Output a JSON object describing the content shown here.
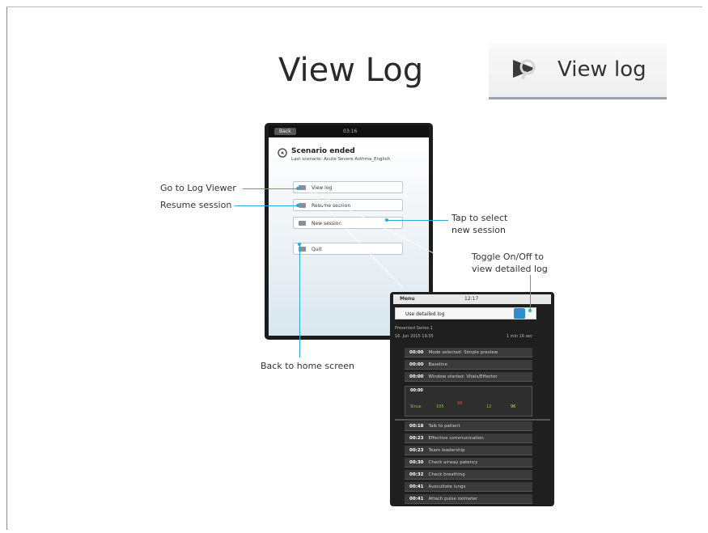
{
  "slide": {
    "title": "View Log",
    "view_log_button_label": "View log"
  },
  "callouts": {
    "go_to_log_viewer": "Go to Log Viewer",
    "resume_session": "Resume session",
    "tap_to_select": "Tap to select",
    "new_session": "new session",
    "toggle_line1": "Toggle On/Off to",
    "toggle_line2": "view detailed log",
    "back_to_home": "Back to home screen"
  },
  "tablet1": {
    "back_label": "Back",
    "time": "03:16",
    "title": "Scenario ended",
    "subtitle": "Last scenario: Acute Severe Asthma_English",
    "buttons": [
      "View log",
      "Resume session",
      "New session",
      "Quit"
    ]
  },
  "tablet2": {
    "menu_label": "Menu",
    "time": "12:17",
    "toggle_label": "Use detailed log",
    "header": "Presented Series 1",
    "date": "16. Jun 2015 19:35",
    "duration": "1 min 16 sec",
    "entries": [
      {
        "time": "00:00",
        "text": "Mode selected: Simple preview"
      },
      {
        "time": "00:00",
        "text": "Baseline"
      },
      {
        "time": "00:00",
        "text": "Window started: Vitals/Effector"
      },
      {
        "time": "00:00",
        "text": ""
      },
      {
        "time": "00:18",
        "text": "Talk to patient"
      },
      {
        "time": "00:23",
        "text": "Effective communication"
      },
      {
        "time": "00:23",
        "text": "Team leadership"
      },
      {
        "time": "00:30",
        "text": "Check airway patency"
      },
      {
        "time": "00:32",
        "text": "Check breathing"
      },
      {
        "time": "00:41",
        "text": "Auscultate lungs"
      },
      {
        "time": "00:41",
        "text": "Attach pulse oximeter"
      }
    ],
    "vitals": [
      "Sinus",
      "105",
      "98",
      "12",
      "96"
    ]
  },
  "colors": {
    "accent": "#2aa9d6",
    "toggle": "#2c8fc8"
  }
}
